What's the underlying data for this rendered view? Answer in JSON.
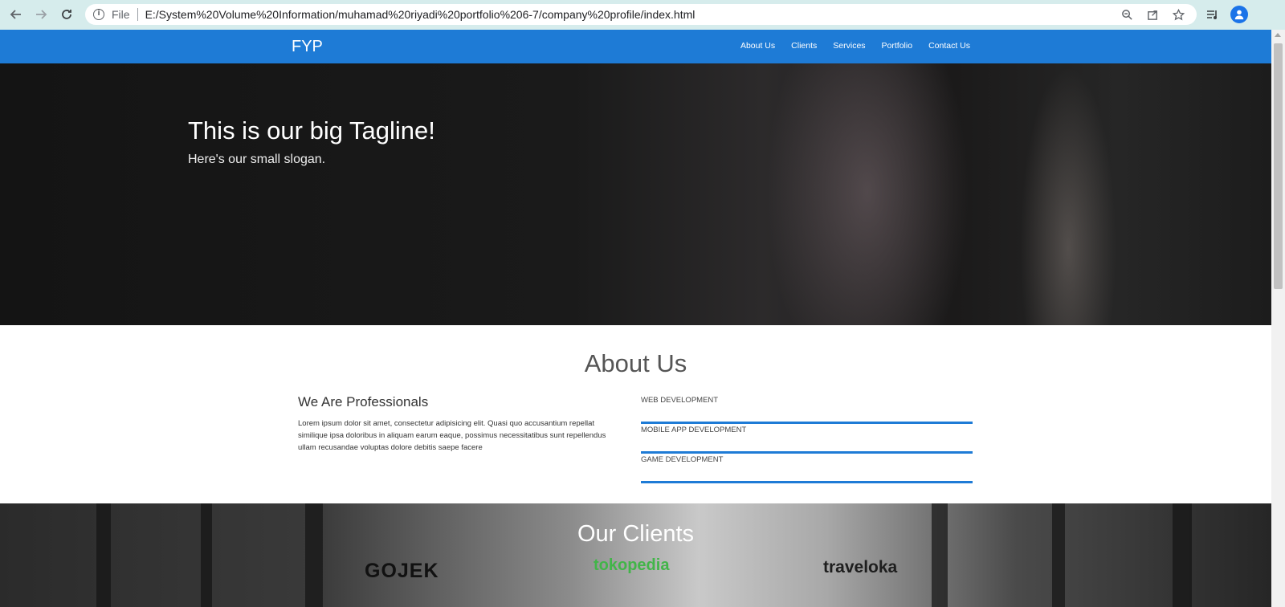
{
  "browser": {
    "file_label": "File",
    "url": "E:/System%20Volume%20Information/muhamad%20riyadi%20portfolio%206-7/company%20profile/index.html"
  },
  "navbar": {
    "brand": "FYP",
    "links": [
      "About Us",
      "Clients",
      "Services",
      "Portfolio",
      "Contact Us"
    ]
  },
  "hero": {
    "tagline": "This is our big Tagline!",
    "slogan": "Here's our small slogan."
  },
  "about": {
    "title": "About Us",
    "subtitle": "We Are Professionals",
    "body": "Lorem ipsum dolor sit amet, consectetur adipisicing elit. Quasi quo accusantium repellat similique ipsa doloribus in aliquam earum eaque, possimus necessitatibus sunt repellendus ullam recusandae voluptas dolore debitis saepe facere",
    "skills": [
      "WEB DEVELOPMENT",
      "MOBILE APP DEVELOPMENT",
      "GAME DEVELOPMENT"
    ]
  },
  "clients": {
    "title": "Our Clients",
    "logos": [
      "GOJEK",
      "tokopedia",
      "traveloka"
    ]
  },
  "colors": {
    "primary": "#1e7bd6",
    "chrome": "#d6ecec"
  }
}
